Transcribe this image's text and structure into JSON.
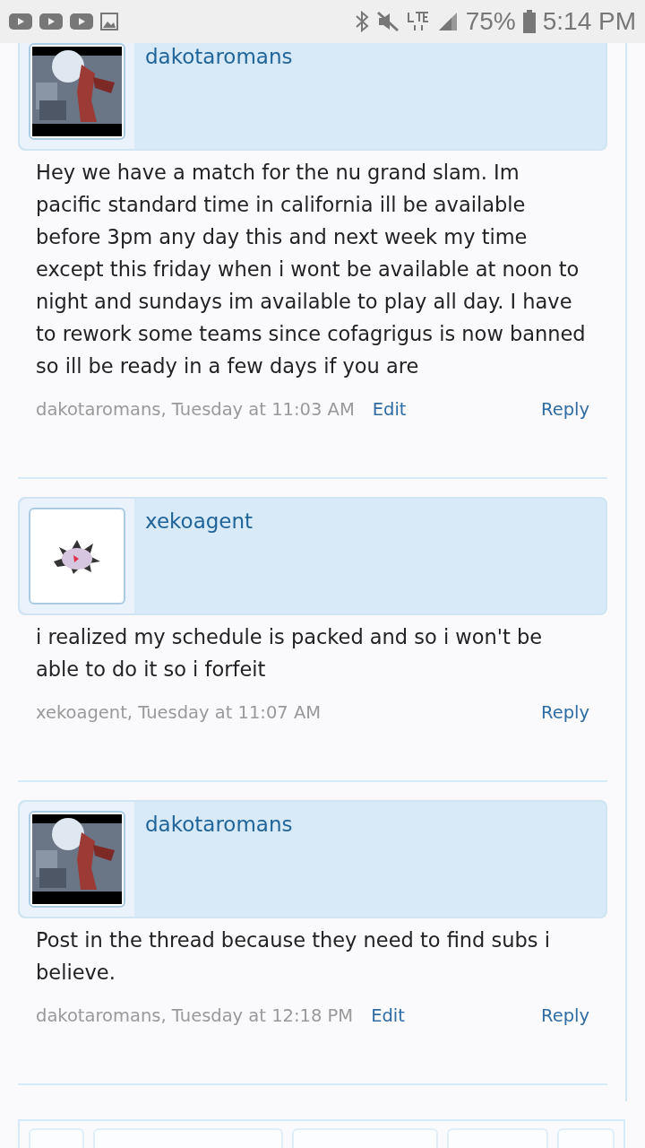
{
  "status_bar": {
    "battery": "75%",
    "time": "5:14 PM"
  },
  "posts": [
    {
      "author": "dakotaromans",
      "message": "Hey we have a match for the nu grand slam. Im pacific standard time in california ill be available before 3pm any day this and next week my time except this friday when i wont be available at noon to night and sundays im available to play all day. I have to rework some teams since cofagrigus is now banned so ill be ready in a few days if you are",
      "meta": "dakotaromans, Tuesday at 11:03 AM",
      "edit": "Edit",
      "reply": "Reply"
    },
    {
      "author": "xekoagent",
      "message": "i realized my schedule is packed and so i won't be able to do it so i forfeit",
      "meta": "xekoagent, Tuesday at 11:07 AM",
      "reply": "Reply"
    },
    {
      "author": "dakotaromans",
      "message": "Post in the thread because they need to find subs i believe.",
      "meta": "dakotaromans, Tuesday at 12:18 PM",
      "edit": "Edit",
      "reply": "Reply"
    }
  ]
}
